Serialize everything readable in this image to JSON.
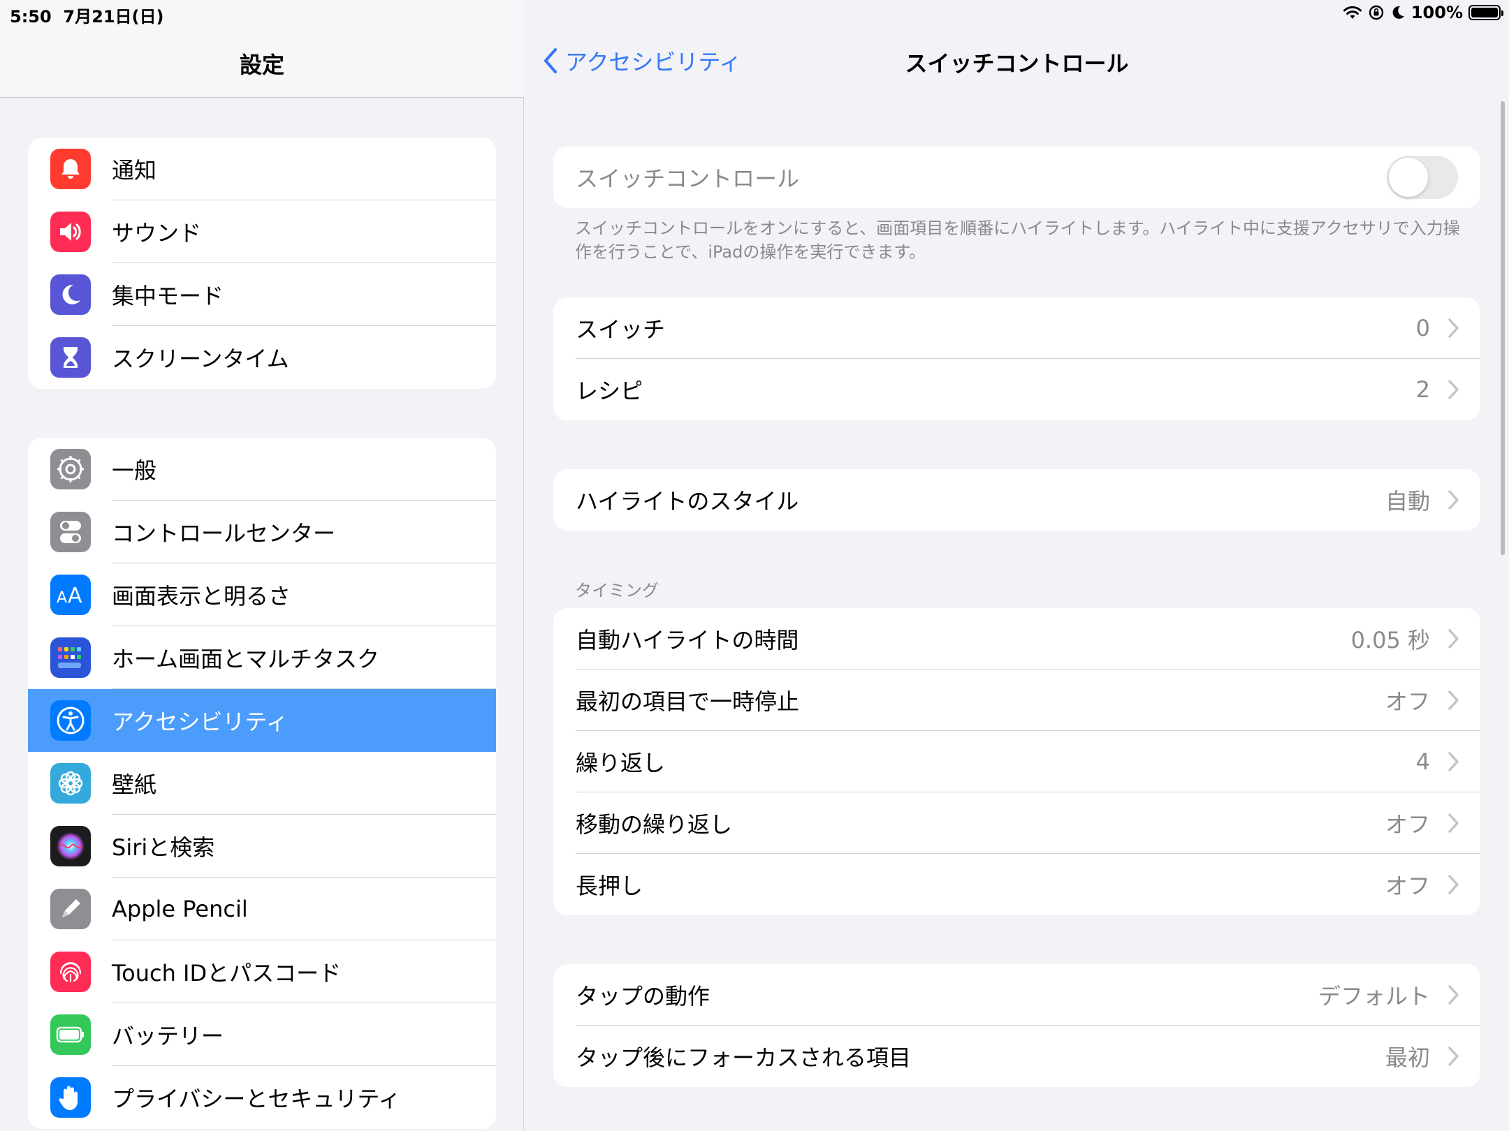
{
  "status_bar": {
    "time": "5:50",
    "date": "7月21日(日)",
    "battery_percent": "100%",
    "battery_level": 1.0
  },
  "sidebar": {
    "title": "設定",
    "groups": [
      [
        {
          "label": "通知",
          "icon": "bell-icon",
          "color": "#ff3b30"
        },
        {
          "label": "サウンド",
          "icon": "speaker-icon",
          "color": "#ff2d55"
        },
        {
          "label": "集中モード",
          "icon": "moon-icon",
          "color": "#5856d6"
        },
        {
          "label": "スクリーンタイム",
          "icon": "hourglass-icon",
          "color": "#5856d6"
        }
      ],
      [
        {
          "label": "一般",
          "icon": "gear-icon",
          "color": "#8e8e93"
        },
        {
          "label": "コントロールセンター",
          "icon": "toggles-icon",
          "color": "#8e8e93"
        },
        {
          "label": "画面表示と明るさ",
          "icon": "text-size-icon",
          "color": "#007aff"
        },
        {
          "label": "ホーム画面とマルチタスク",
          "icon": "home-grid-icon",
          "color": "#2c54d9"
        },
        {
          "label": "アクセシビリティ",
          "icon": "accessibility-icon",
          "color": "#007aff",
          "selected": true
        },
        {
          "label": "壁紙",
          "icon": "flower-icon",
          "color": "#34aadc"
        },
        {
          "label": "Siriと検索",
          "icon": "siri-icon",
          "color": "#1c1c1e"
        },
        {
          "label": "Apple Pencil",
          "icon": "pencil-icon",
          "color": "#8e8e93"
        },
        {
          "label": "Touch IDとパスコード",
          "icon": "fingerprint-icon",
          "color": "#ff2d55"
        },
        {
          "label": "バッテリー",
          "icon": "battery-icon",
          "color": "#34c759"
        },
        {
          "label": "プライバシーとセキュリティ",
          "icon": "hand-icon",
          "color": "#007aff"
        }
      ]
    ]
  },
  "detail": {
    "back_label": "アクセシビリティ",
    "title": "スイッチコントロール",
    "toggle_row": {
      "label": "スイッチコントロール",
      "on": false
    },
    "footnote": "スイッチコントロールをオンにすると、画面項目を順番にハイライトします。ハイライト中に支援アクセサリで入力操作を行うことで、iPadの操作を実行できます。",
    "group_switches": [
      {
        "label": "スイッチ",
        "value": "0"
      },
      {
        "label": "レシピ",
        "value": "2"
      }
    ],
    "group_highlight": [
      {
        "label": "ハイライトのスタイル",
        "value": "自動"
      }
    ],
    "timing_header": "タイミング",
    "group_timing": [
      {
        "label": "自動ハイライトの時間",
        "value": "0.05 秒"
      },
      {
        "label": "最初の項目で一時停止",
        "value": "オフ"
      },
      {
        "label": "繰り返し",
        "value": "4"
      },
      {
        "label": "移動の繰り返し",
        "value": "オフ"
      },
      {
        "label": "長押し",
        "value": "オフ"
      }
    ],
    "group_tap": [
      {
        "label": "タップの動作",
        "value": "デフォルト"
      },
      {
        "label": "タップ後にフォーカスされる項目",
        "value": "最初"
      }
    ]
  },
  "colors": {
    "accent": "#3478f6",
    "selected_row": "#4c9dfb",
    "secondary_text": "#8a8a8e"
  }
}
